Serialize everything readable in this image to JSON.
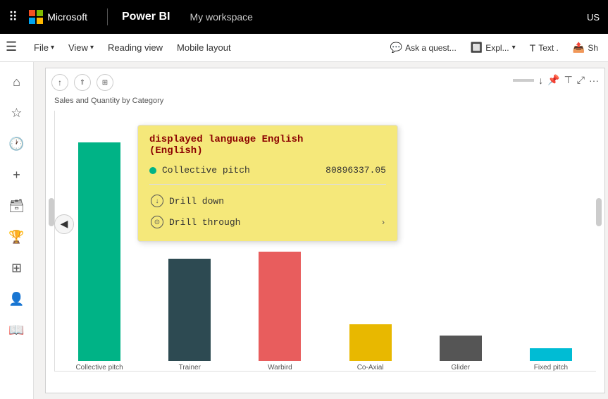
{
  "topnav": {
    "app_name": "Power BI",
    "workspace": "My workspace",
    "user": "US"
  },
  "menubar": {
    "items": [
      {
        "label": "File",
        "has_chevron": true
      },
      {
        "label": "View",
        "has_chevron": true
      },
      {
        "label": "Reading view",
        "has_chevron": false
      },
      {
        "label": "Mobile layout",
        "has_chevron": false
      }
    ],
    "right_items": [
      {
        "label": "Ask a quest...",
        "icon": "chat"
      },
      {
        "label": "Expl...",
        "icon": "explore",
        "has_chevron": true
      },
      {
        "label": "Text ...",
        "icon": "text"
      },
      {
        "label": "Sh",
        "icon": "share"
      }
    ]
  },
  "sidebar": {
    "icons": [
      {
        "name": "home-icon",
        "symbol": "⌂",
        "active": false
      },
      {
        "name": "star-icon",
        "symbol": "☆",
        "active": false
      },
      {
        "name": "clock-icon",
        "symbol": "⏱",
        "active": false
      },
      {
        "name": "plus-icon",
        "symbol": "+",
        "active": false
      },
      {
        "name": "cylinder-icon",
        "symbol": "⬡",
        "active": false
      },
      {
        "name": "trophy-icon",
        "symbol": "🏆",
        "active": false
      },
      {
        "name": "grid-icon",
        "symbol": "⊞",
        "active": false
      },
      {
        "name": "people-icon",
        "symbol": "👤",
        "active": false
      },
      {
        "name": "book-icon",
        "symbol": "📖",
        "active": false
      }
    ]
  },
  "chart": {
    "title": "Sales and Quantity by Category",
    "controls": {
      "up_arrow": "↑",
      "drill_up": "⇑",
      "expand": "⊞",
      "download": "↓",
      "pin": "📌",
      "filter": "⊤",
      "focus": "⤢",
      "more": "···"
    },
    "bars": [
      {
        "label": "Collective pitch",
        "color": "#00b386",
        "height_pct": 85
      },
      {
        "label": "Trainer",
        "color": "#2d4a52",
        "height_pct": 40
      },
      {
        "label": "Warbird",
        "color": "#e85d5d",
        "height_pct": 42
      },
      {
        "label": "Co-Axial",
        "color": "#e8b800",
        "height_pct": 14
      },
      {
        "label": "Glider",
        "color": "#555555",
        "height_pct": 10
      },
      {
        "label": "Fixed pitch",
        "color": "#00bcd4",
        "height_pct": 5
      }
    ]
  },
  "tooltip": {
    "title": "displayed language English\n(English)",
    "title_line1": "displayed language English",
    "title_line2": "(English)",
    "data_rows": [
      {
        "dot_color": "#00b386",
        "key": "Collective pitch",
        "value": "80896337.05"
      }
    ],
    "actions": [
      {
        "label": "Drill down",
        "icon": "↓",
        "has_chevron": false
      },
      {
        "label": "Drill through",
        "icon": "→",
        "has_chevron": true
      }
    ]
  }
}
